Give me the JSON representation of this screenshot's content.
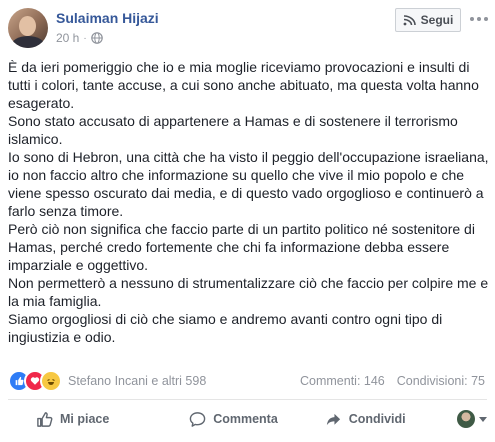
{
  "header": {
    "author_name": "Sulaiman Hijazi",
    "time": "20 h",
    "separator": "·",
    "follow_label": "Segui",
    "icons": {
      "privacy": "globe-icon",
      "follow": "follow-rss-icon",
      "more": "more-options-icon"
    }
  },
  "post": {
    "paragraphs": [
      "È da ieri pomeriggio che io e mia moglie riceviamo provocazioni e insulti di tutti i colori, tante accuse, a cui sono anche abituato, ma questa volta hanno esagerato.",
      "Sono stato accusato di appartenere a Hamas e di sostenere il terrorismo islamico.",
      "Io sono di Hebron, una città che ha visto il peggio dell'occupazione israeliana, io non faccio altro che informazione su quello che vive il mio popolo e che viene spesso oscurato dai media, e di questo vado orgoglioso e continuerò a farlo senza timore.",
      "Però ciò non significa che faccio parte di un partito politico né sostenitore di Hamas, perché credo fortemente che chi fa informazione debba essere imparziale e oggettivo.",
      "Non permetterò a nessuno di strumentalizzare ciò che faccio per colpire me e la mia famiglia.",
      "Siamo orgogliosi di ciò che siamo e andremo avanti contro ogni tipo di ingiustizia e odio."
    ]
  },
  "reactions": {
    "types": [
      "like",
      "love",
      "haha"
    ],
    "summary": "Stefano Incani e altri 598",
    "comments": "Commenti: 146",
    "shares": "Condivisioni: 75"
  },
  "actions": {
    "like_label": "Mi piace",
    "comment_label": "Commenta",
    "share_label": "Condividi"
  },
  "colors": {
    "author_link": "#365899",
    "like_reaction": "#2e7cf6",
    "love_reaction": "#f0284a",
    "haha_reaction": "#f7c842",
    "muted_text": "#90949c"
  }
}
